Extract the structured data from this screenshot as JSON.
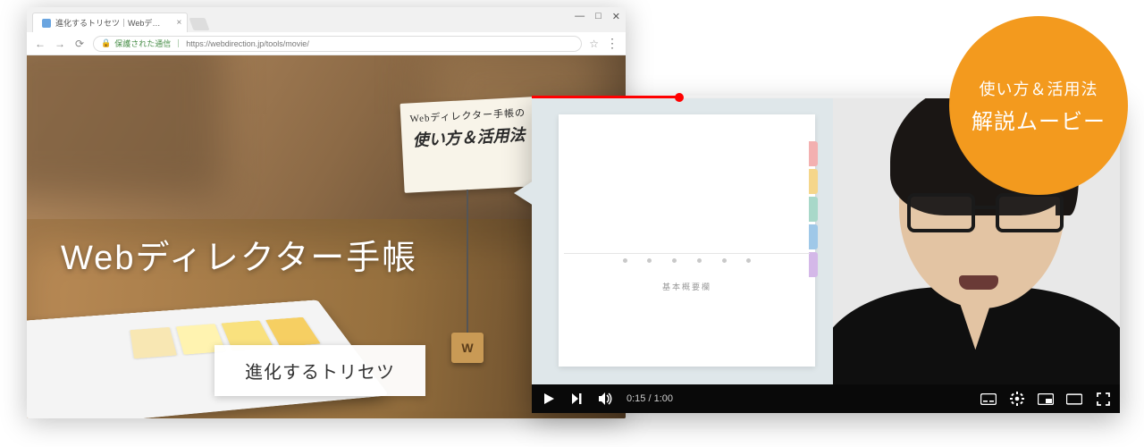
{
  "browser": {
    "tab_title": "進化するトリセツ｜Webデ…",
    "win_controls": {
      "min": "—",
      "max": "□",
      "close": "✕"
    },
    "nav": {
      "back": "←",
      "fwd": "→",
      "reload": "⟳"
    },
    "secure_label": "保護された通信",
    "url": "https://webdirection.jp/tools/movie/",
    "menu": "⋮"
  },
  "site": {
    "card_line1": "Webディレクター手帳の",
    "card_line2": "使い方＆活用法",
    "hero_title": "Webディレクター手帳",
    "sub_button": "進化するトリセツ"
  },
  "video": {
    "paper_label": "基本概要欄",
    "time_current": "0:15",
    "time_total": "1:00",
    "progress_percent": 25
  },
  "badge": {
    "line1": "使い方＆活用法",
    "line2": "解説ムービー"
  }
}
